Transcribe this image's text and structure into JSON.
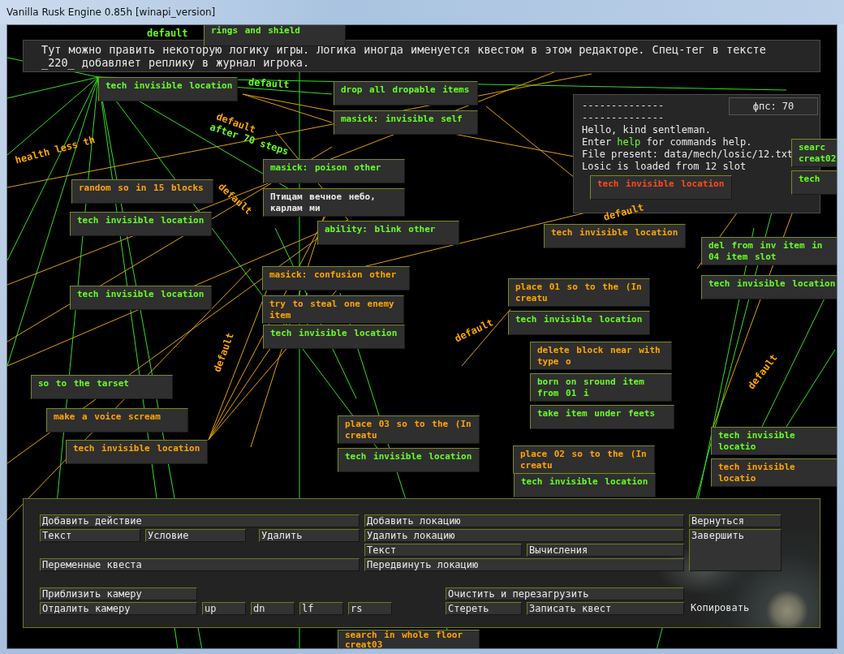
{
  "window": {
    "title": "Vanilla Rusk Engine 0.85h [winapi_version]"
  },
  "banner": {
    "lines": [
      "Тут можно править некоторую логику игры. Логика иногда именуется квестом в этом редакторе. Спец-тег в тексте",
      "_220_ добавляет реплику в журнал игрока."
    ]
  },
  "console": {
    "fps": "фпс: 70",
    "lines": [
      {
        "parts": [
          {
            "text": "--------------",
            "kind": "plain"
          }
        ]
      },
      {
        "parts": [
          {
            "text": "--------------",
            "kind": "plain"
          }
        ]
      },
      {
        "parts": [
          {
            "text": "Hello, kind sentleman.",
            "kind": "plain"
          }
        ]
      },
      {
        "parts": [
          {
            "text": "Enter ",
            "kind": "plain"
          },
          {
            "text": "help",
            "kind": "command"
          },
          {
            "text": " for commands help.",
            "kind": "plain"
          }
        ]
      },
      {
        "parts": [
          {
            "text": "File present: data/mech/losic/12.txt",
            "kind": "plain"
          }
        ]
      },
      {
        "parts": [
          {
            "text": "Losic is loaded from 12 slot",
            "kind": "plain"
          }
        ]
      }
    ]
  },
  "nodes": [
    {
      "text": "rings and shield",
      "color": "#66ff22"
    },
    {
      "text": "tech invisible location",
      "color": "#66ff22"
    },
    {
      "text": "drop all dropable items",
      "color": "#66ff22"
    },
    {
      "text": "masick: invisible self",
      "color": "#66ff22"
    },
    {
      "text": "random so in 15 blocks",
      "color": "#ffa500"
    },
    {
      "text": "tech invisible location",
      "color": "#66ff22"
    },
    {
      "text": "masick: poison other",
      "color": "#66ff22"
    },
    {
      "text": "Птицам вечное небо, карлам ми",
      "color": "#e8e8e8"
    },
    {
      "text": "ability: blink other",
      "color": "#66ff22"
    },
    {
      "text": "tech invisible location",
      "color": "#66ff22"
    },
    {
      "text": "masick: confusion other",
      "color": "#ffa500"
    },
    {
      "text": "try to steal one enemy item",
      "color": "#ffa500"
    },
    {
      "text": "tech invisible location",
      "color": "#66ff22"
    },
    {
      "text": "so to the tarset",
      "color": "#66ff22"
    },
    {
      "text": "make a voice scream",
      "color": "#ffa500"
    },
    {
      "text": "tech invisible location",
      "color": "#ffa500"
    },
    {
      "text": "place 03 so to the (In creatu",
      "color": "#ffa500"
    },
    {
      "text": "tech invisible location",
      "color": "#66ff22"
    },
    {
      "text": "tech invisible location",
      "color": "#ffa500"
    },
    {
      "text": "place 01 so to the (In creatu",
      "color": "#ffa500"
    },
    {
      "text": "tech invisible location",
      "color": "#66ff22"
    },
    {
      "text": "delete block near with type o",
      "color": "#ffa500"
    },
    {
      "text": "born on sround item from 01 i",
      "color": "#66ff22"
    },
    {
      "text": "take item under feets",
      "color": "#66ff22"
    },
    {
      "text": "place 02 so to the (In creatu",
      "color": "#ffa500"
    },
    {
      "text": "tech invisible location",
      "color": "#66ff22"
    },
    {
      "text": "del from inv item in 04 item slot",
      "color": "#66ff22"
    },
    {
      "text": "tech invisible location",
      "color": "#66ff22"
    },
    {
      "text": "tech invisible locatio",
      "color": "#66ff22"
    },
    {
      "text": "tech invisible locatio",
      "color": "#ffa500"
    },
    {
      "text": "searc creat02",
      "color": "#66ff22"
    },
    {
      "text": "tech",
      "color": "#66ff22"
    },
    {
      "text": "tech invisible location",
      "color": "#ff4a1a"
    },
    {
      "text": "search in whole floor creat03",
      "color": "#ffa500"
    }
  ],
  "edge_labels": [
    {
      "text": "default",
      "color": "#66ff22"
    },
    {
      "text": "default",
      "color": "#66ff22"
    },
    {
      "text": "default",
      "color": "#ffa500"
    },
    {
      "text": "after 70 steps",
      "color": "#66ff22"
    },
    {
      "text": "health less th",
      "color": "#ffa500"
    },
    {
      "text": "default",
      "color": "#ffa500"
    },
    {
      "text": "default",
      "color": "#ffa500"
    },
    {
      "text": "default",
      "color": "#ffa500"
    },
    {
      "text": "default",
      "color": "#ffa500"
    },
    {
      "text": "default",
      "color": "#ffa500"
    }
  ],
  "controls": [
    {
      "label": "Добавить действие",
      "kind": "button"
    },
    {
      "label": "Добавить локацию",
      "kind": "button"
    },
    {
      "label": "Вернуться",
      "kind": "button"
    },
    {
      "label": "Текст",
      "kind": "button"
    },
    {
      "label": "Условие",
      "kind": "button"
    },
    {
      "label": "Удалить",
      "kind": "button"
    },
    {
      "label": "Удалить локацию",
      "kind": "button"
    },
    {
      "label": "Завершить",
      "kind": "button"
    },
    {
      "label": "Текст",
      "kind": "button"
    },
    {
      "label": "Вычисления",
      "kind": "button"
    },
    {
      "label": "Переменные квеста",
      "kind": "button"
    },
    {
      "label": "Передвинуть локацию",
      "kind": "button"
    },
    {
      "label": "Приблизить камеру",
      "kind": "button"
    },
    {
      "label": "Очистить и перезагрузить",
      "kind": "button"
    },
    {
      "label": "Отдалить камеру",
      "kind": "button"
    },
    {
      "label": "up",
      "kind": "button"
    },
    {
      "label": "dn",
      "kind": "button"
    },
    {
      "label": "lf",
      "kind": "button"
    },
    {
      "label": "rs",
      "kind": "button"
    },
    {
      "label": "Стереть",
      "kind": "button"
    },
    {
      "label": "Записать квест",
      "kind": "button"
    },
    {
      "label": "Копировать",
      "kind": "label"
    }
  ]
}
